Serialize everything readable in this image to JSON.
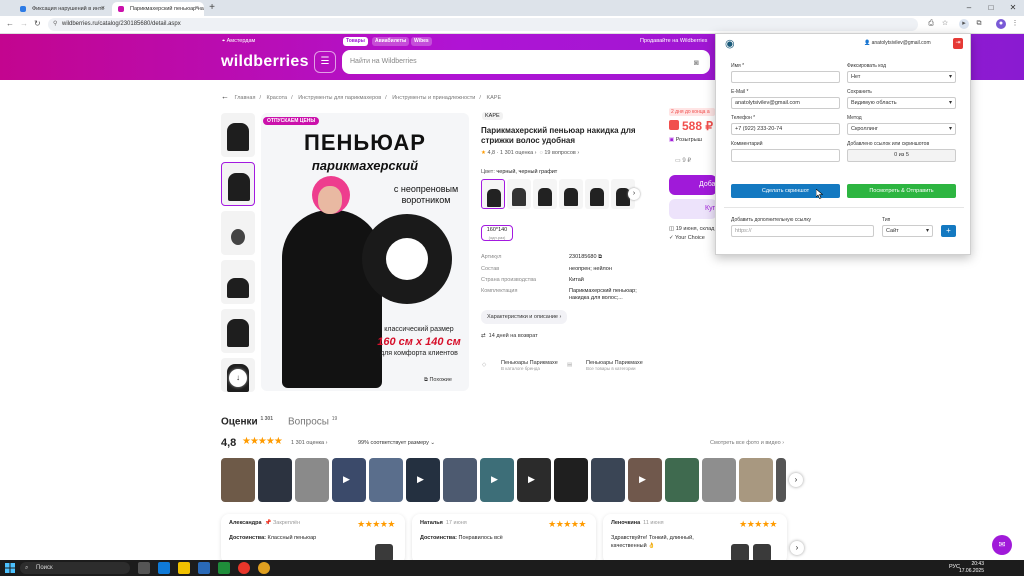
{
  "browser": {
    "tabs": [
      {
        "title": "Фиксация нарушений в инте",
        "color": "#2d7be5"
      },
      {
        "title": "Парикмахерский пеньюар на",
        "color": "#cb11ab"
      }
    ],
    "url": "wildberries.ru/catalog/230185680/detail.aspx"
  },
  "header": {
    "city": "Амстердам",
    "pills": [
      "Товары",
      "Авиабилеты",
      "Wibes"
    ],
    "sell": "Продавайте на Wildberries",
    "logo": "wildberries",
    "search_placeholder": "Найти на Wildberries"
  },
  "breadcrumbs": [
    "Главная",
    "Красота",
    "Инструменты для парикмахеров",
    "Инструменты и принадлежности",
    "KAPE"
  ],
  "gallery": {
    "badge": "ОТПУСКАЕМ ЦЕНЫ",
    "title1": "ПЕНЬЮАР",
    "title2": "парикмахерский",
    "title3": "с неопреновым воротником",
    "size_intro": "классический размер",
    "size": "160 см х 140 см",
    "size_note": "для комфорта клиентов",
    "similar": "Похожие"
  },
  "product": {
    "brand": "KAPE",
    "title": "Парикмахерский пеньюар накидка для стрижки волос удобная",
    "rating": "4,8",
    "reviews": "1 301 оценка",
    "questions": "19 вопросов",
    "color_label": "Цвет:",
    "color_value": "черный, черный графит",
    "size_value": "160*140",
    "size_sub": "(одн.раз)",
    "specs": [
      {
        "k": "Артикул",
        "v": "230185680"
      },
      {
        "k": "Состав",
        "v": "неопрен; нейлон"
      },
      {
        "k": "Страна производства",
        "v": "Китай"
      },
      {
        "k": "Комплектация",
        "v": "Парикмахерский пеньюар; накидка для волос;..."
      }
    ],
    "characteristics_btn": "Характеристики и описание",
    "return": "14 дней на возврат",
    "cat1_title": "Пеньюары Парикмахе",
    "cat1_sub": "В каталоге бренда",
    "cat2_title": "Пеньюары Парикмахе",
    "cat2_sub": "Все товары в категории"
  },
  "price": {
    "deliv_tag": "2 дня до конца а",
    "value": "588 ₽",
    "raffle": "Розыгрыш",
    "wb_price": "9 ₽",
    "add_cart": "Добав",
    "buy_now": "Куп",
    "delivery": "19 июня, склад",
    "your_choice": "Your Choice"
  },
  "reviews": {
    "tab": "Оценки",
    "tab_count": "1 301",
    "questions_tab": "Вопросы",
    "questions_count": "19",
    "score": "4,8",
    "stars": "★★★★★",
    "count": "1 301 оценка",
    "match": "99% соответствует размеру",
    "all_photos": "Смотреть все фото и видео",
    "cards": [
      {
        "name": "Александра",
        "date": "Закреплён",
        "text_label": "Достоинства:",
        "text": "Классный пеньюар"
      },
      {
        "name": "Наталья",
        "date": "17 июня",
        "text_label": "Достоинства:",
        "text": "Понравилось всё"
      },
      {
        "name": "Леночкина",
        "date": "11 июня",
        "text_label": "",
        "text": "Здравствуйте! Тонкий, длинный, качественный 👌"
      }
    ]
  },
  "extension": {
    "user": "anatolytsivilev@gmail.com",
    "name_label": "Имя *",
    "name_value": "",
    "fix_label": "Фиксировать код",
    "fix_value": "Нет",
    "email_label": "E-Mail *",
    "email_value": "anatolytsivilev@gmail.com",
    "save_label": "Сохранить",
    "save_value": "Видимую область",
    "phone_label": "Телефон *",
    "phone_value": "+7 (922) 233-20-74",
    "method_label": "Метод",
    "method_value": "Скроллинг",
    "comment_label": "Комментарий",
    "added_label": "Добавлено ссылок или скриншотов",
    "added_value": "0 из 5",
    "shot_btn": "Сделать скриншот",
    "send_btn": "Посмотреть & Отправить",
    "link_label": "Добавить дополнительную ссылку",
    "link_placeholder": "https://",
    "type_label": "Тип",
    "type_value": "Сайт",
    "plus": "+"
  },
  "taskbar": {
    "search": "Поиск",
    "lang": "РУС",
    "time": "20:43",
    "date": "17.06.2025"
  }
}
